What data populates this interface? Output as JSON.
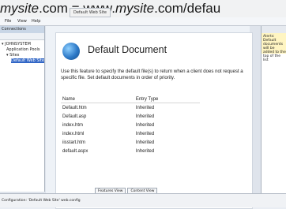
{
  "watermark": {
    "part1_italic": "mysite",
    "part2": ".com = www.",
    "part3_italic": "mysite",
    "part4": ".com/defau"
  },
  "window": {
    "tab_label": "Default Web Site"
  },
  "menu": {
    "items": [
      "File",
      "View",
      "Help"
    ]
  },
  "connections": {
    "header": "Connections",
    "tree": [
      "JOHNSYSTEM",
      "Application Pools",
      "Sites",
      "Default Web Site"
    ]
  },
  "feature": {
    "title": "Default Document",
    "description": "Use this feature to specify the default file(s) to return when a client does not request a specific file. Set default documents in order of priority.",
    "columns": [
      "Name",
      "Entry Type"
    ],
    "rows": [
      {
        "name": "Default.htm",
        "entry_type": "Inherited"
      },
      {
        "name": "Default.asp",
        "entry_type": "Inherited"
      },
      {
        "name": "index.htm",
        "entry_type": "Inherited"
      },
      {
        "name": "index.html",
        "entry_type": "Inherited"
      },
      {
        "name": "iisstart.htm",
        "entry_type": "Inherited"
      },
      {
        "name": "default.aspx",
        "entry_type": "Inherited"
      }
    ]
  },
  "views": {
    "features_view": "Features View",
    "content_view": "Content View"
  },
  "actions": {
    "alert_text": "Alerts: Default documents will be added to the top of the list"
  },
  "status": {
    "text": "Configuration: 'Default Web Site' web.config"
  }
}
